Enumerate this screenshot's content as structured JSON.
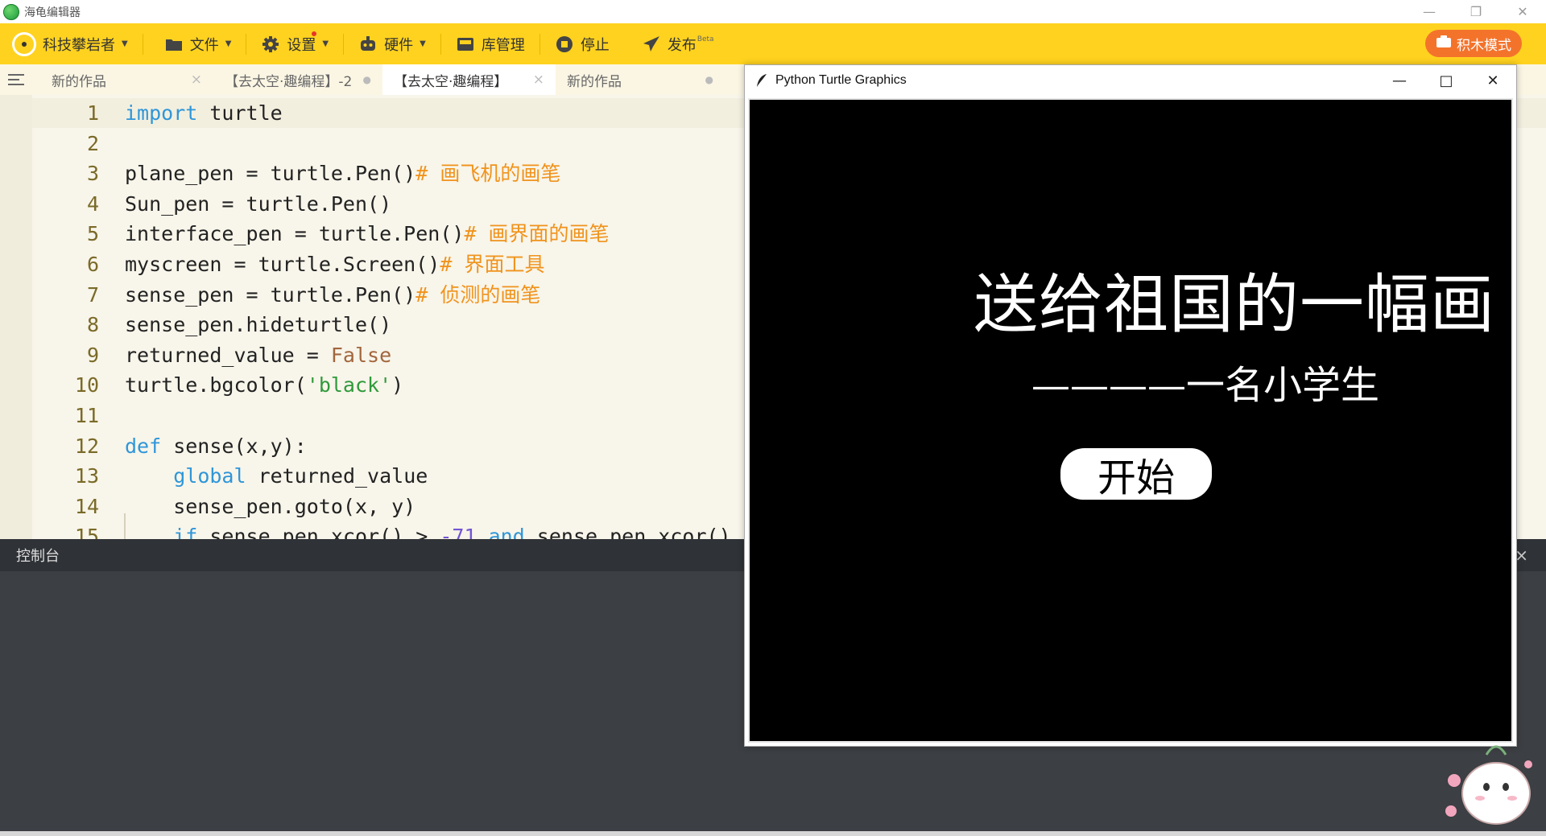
{
  "app": {
    "title": "海龟编辑器"
  },
  "toolbar": {
    "user": "科技攀岩者",
    "file": "文件",
    "settings": "设置",
    "hardware": "硬件",
    "library": "库管理",
    "stop": "停止",
    "publish": "发布",
    "publish_badge": "Beta",
    "blocks_mode": "积木模式"
  },
  "tabs": [
    {
      "label": "新的作品",
      "marker": "×"
    },
    {
      "label": "【去太空·趣编程】-2",
      "marker": "●"
    },
    {
      "label": "【去太空·趣编程】",
      "marker": "×"
    },
    {
      "label": "新的作品",
      "marker": "●"
    }
  ],
  "editor": {
    "lines": [
      {
        "n": "1",
        "segments": [
          [
            "kw",
            "import"
          ],
          [
            "txt",
            " turtle"
          ]
        ]
      },
      {
        "n": "2",
        "segments": []
      },
      {
        "n": "3",
        "segments": [
          [
            "txt",
            "plane_pen = turtle.Pen()"
          ],
          [
            "cm",
            "# 画飞机的画笔"
          ]
        ]
      },
      {
        "n": "4",
        "segments": [
          [
            "txt",
            "Sun_pen = turtle.Pen()"
          ]
        ]
      },
      {
        "n": "5",
        "segments": [
          [
            "txt",
            "interface_pen = turtle.Pen()"
          ],
          [
            "cm",
            "# 画界面的画笔"
          ]
        ]
      },
      {
        "n": "6",
        "segments": [
          [
            "txt",
            "myscreen = turtle.Screen()"
          ],
          [
            "cm",
            "# 界面工具"
          ]
        ]
      },
      {
        "n": "7",
        "segments": [
          [
            "txt",
            "sense_pen = turtle.Pen()"
          ],
          [
            "cm",
            "# 侦测的画笔"
          ]
        ]
      },
      {
        "n": "8",
        "segments": [
          [
            "txt",
            "sense_pen.hideturtle()"
          ]
        ]
      },
      {
        "n": "9",
        "segments": [
          [
            "txt",
            "returned_value = "
          ],
          [
            "const",
            "False"
          ]
        ]
      },
      {
        "n": "10",
        "segments": [
          [
            "txt",
            "turtle.bgcolor("
          ],
          [
            "str",
            "'black'"
          ],
          [
            "txt",
            ")"
          ]
        ]
      },
      {
        "n": "11",
        "segments": []
      },
      {
        "n": "12",
        "segments": [
          [
            "kw",
            "def"
          ],
          [
            "txt",
            " sense(x,y):"
          ]
        ]
      },
      {
        "n": "13",
        "segments": [
          [
            "txt",
            "    "
          ],
          [
            "kw",
            "global"
          ],
          [
            "txt",
            " returned_value"
          ]
        ]
      },
      {
        "n": "14",
        "segments": [
          [
            "txt",
            "    sense_pen.goto(x, y)"
          ]
        ]
      },
      {
        "n": "15",
        "segments": [
          [
            "txt",
            "    "
          ],
          [
            "kw",
            "if"
          ],
          [
            "txt",
            " sense_pen.xcor() > "
          ],
          [
            "num",
            "-71"
          ],
          [
            "txt",
            " "
          ],
          [
            "kw",
            "and"
          ],
          [
            "txt",
            " sense_pen.xcor()"
          ]
        ]
      }
    ]
  },
  "console": {
    "title": "控制台",
    "close": "×"
  },
  "turtle_window": {
    "title": "Python Turtle Graphics",
    "canvas_title": "送给祖国的一幅画",
    "canvas_subtitle": "————一名小学生",
    "start_button": "开始"
  },
  "colors": {
    "toolbar": "#ffd21f",
    "blocks_button": "#f4732b",
    "editor_bg": "#f8f5ea",
    "console_bg": "#3c3f43",
    "keyword": "#2f96d8",
    "comment": "#f0931c",
    "string": "#2e9a3a"
  }
}
